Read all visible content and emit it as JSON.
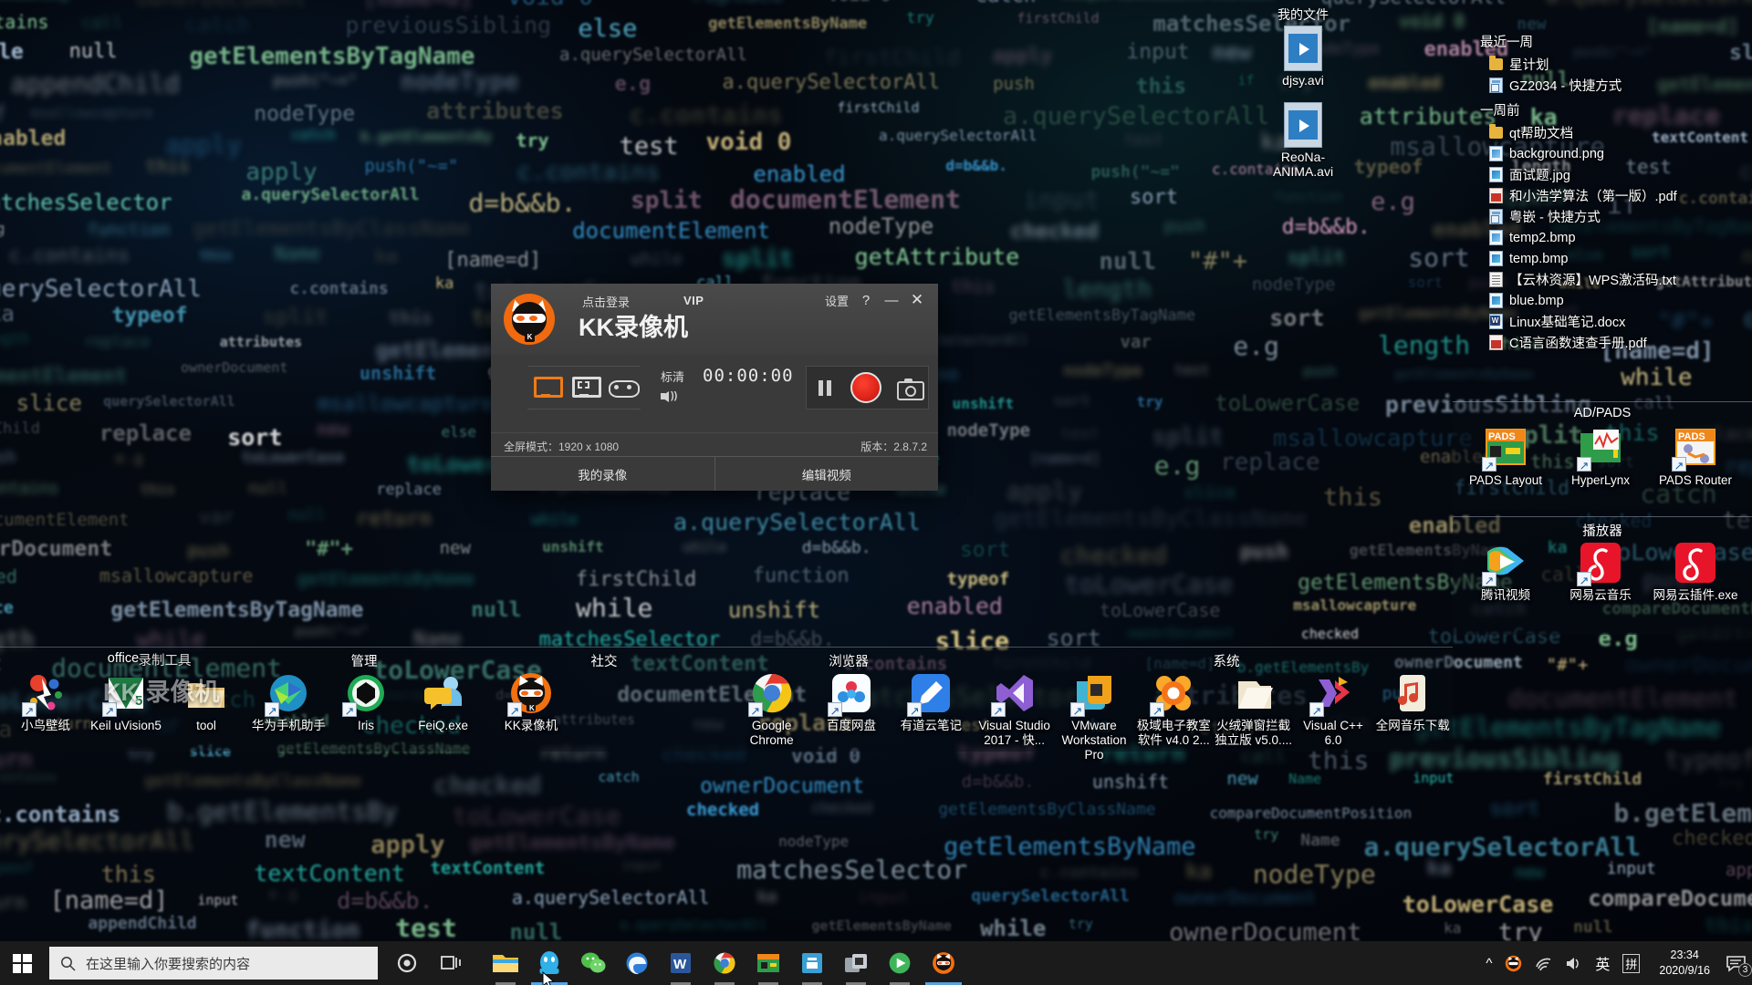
{
  "desktop": {
    "file_list": {
      "groups": [
        {
          "label": "最近一周",
          "items": [
            {
              "name": "星计划",
              "icon": "folder-icon",
              "type": "folder"
            },
            {
              "name": "GZ2034 - 快捷方式",
              "icon": "shortcut-icon",
              "type": "lnk"
            }
          ]
        },
        {
          "label": "一周前",
          "items": [
            {
              "name": "qt帮助文档",
              "icon": "folder-icon",
              "type": "folder"
            },
            {
              "name": "background.png",
              "icon": "image-file-icon",
              "type": "img"
            },
            {
              "name": "面试题.jpg",
              "icon": "image-file-icon",
              "type": "img2"
            },
            {
              "name": "和小浩学算法（第一版）.pdf",
              "icon": "pdf-file-icon",
              "type": "pdf"
            },
            {
              "name": "粤嵌 - 快捷方式",
              "icon": "shortcut-icon",
              "type": "lnk"
            },
            {
              "name": "temp2.bmp",
              "icon": "image-file-icon",
              "type": "img"
            },
            {
              "name": "temp.bmp",
              "icon": "image-file-icon",
              "type": "img2"
            },
            {
              "name": "【云林资源】WPS激活码.txt",
              "icon": "text-file-icon",
              "type": "txt"
            },
            {
              "name": "blue.bmp",
              "icon": "image-file-icon",
              "type": "img2"
            },
            {
              "name": "Linux基础笔记.docx",
              "icon": "word-file-icon",
              "type": "docx"
            },
            {
              "name": "C语言函数速查手册.pdf",
              "icon": "pdf-file-icon",
              "type": "pdf"
            }
          ]
        }
      ]
    },
    "video_icons": [
      {
        "label": "我的文件",
        "file": "djsy.avi",
        "icon": "avi-file-icon"
      },
      {
        "label": "",
        "file": "ReoNa-ANIMA.avi",
        "icon": "avi-file-icon"
      }
    ],
    "fences": [
      {
        "title": "office",
        "items": [
          {
            "label": "小鸟壁纸",
            "icon": "bird-wallpaper-icon",
            "shortcut": true
          },
          {
            "label": "Keil uVision5",
            "icon": "keil-uvision-icon",
            "shortcut": true
          },
          {
            "label": "tool",
            "icon": "folder-open-icon",
            "shortcut": false
          }
        ]
      },
      {
        "title": "录制工具",
        "items": [
          {
            "label": "KK 录像机",
            "icon": "kk-recorder-watermark-icon",
            "shortcut": false
          }
        ]
      },
      {
        "title": "管理",
        "items": [
          {
            "label": "华为手机助手",
            "icon": "huawei-hisuite-icon",
            "shortcut": true
          },
          {
            "label": "Iris",
            "icon": "iris-icon",
            "shortcut": true
          },
          {
            "label": "FeiQ.exe",
            "icon": "feiq-icon",
            "shortcut": false
          }
        ]
      },
      {
        "title": "社交",
        "items": [
          {
            "label": "KK录像机",
            "icon": "kk-recorder-icon",
            "shortcut": true
          }
        ]
      },
      {
        "title": "浏览器",
        "items": [
          {
            "label": "Google Chrome",
            "icon": "chrome-icon",
            "shortcut": true
          },
          {
            "label": "百度网盘",
            "icon": "baidu-netdisk-icon",
            "shortcut": true
          },
          {
            "label": "有道云笔记",
            "icon": "youdao-note-icon",
            "shortcut": true
          }
        ]
      },
      {
        "title": "系统",
        "items": [
          {
            "label": "Visual Studio 2017 - 快...",
            "icon": "visual-studio-icon",
            "shortcut": true
          },
          {
            "label": "VMware Workstation Pro",
            "icon": "vmware-icon",
            "shortcut": true
          },
          {
            "label": "极域电子教室软件 v4.0 2...",
            "icon": "jiyu-classroom-icon",
            "shortcut": true
          },
          {
            "label": "火绒弹窗拦截独立版 v5.0....",
            "icon": "huorong-popup-icon",
            "shortcut": false
          },
          {
            "label": "Visual C++ 6.0",
            "icon": "visual-cpp-icon",
            "shortcut": true
          },
          {
            "label": "全网音乐下载",
            "icon": "music-download-icon",
            "shortcut": false
          }
        ]
      },
      {
        "title": "AD/PADS",
        "items": [
          {
            "label": "PADS Layout",
            "icon": "pads-layout-icon",
            "shortcut": true
          },
          {
            "label": "HyperLynx",
            "icon": "hyperlynx-icon",
            "shortcut": true
          },
          {
            "label": "PADS Router",
            "icon": "pads-router-icon",
            "shortcut": true
          }
        ]
      },
      {
        "title": "播放器",
        "items": [
          {
            "label": "腾讯视频",
            "icon": "tencent-video-icon",
            "shortcut": true
          },
          {
            "label": "网易云音乐",
            "icon": "netease-music-icon",
            "shortcut": true
          },
          {
            "label": "网易云插件.exe",
            "icon": "netease-plugin-icon",
            "shortcut": false
          }
        ]
      }
    ]
  },
  "kk_window": {
    "login_text": "点击登录",
    "vip_label": "VIP",
    "app_name": "KK录像机",
    "settings_label": "设置",
    "help_icon": "?",
    "minimize_icon": "—",
    "close_icon": "✕",
    "modes": [
      {
        "name": "fullscreen-mode",
        "icon": "monitor-icon",
        "selected": true
      },
      {
        "name": "region-mode",
        "icon": "region-select-icon",
        "selected": false
      },
      {
        "name": "game-mode",
        "icon": "gamepad-icon",
        "selected": false
      }
    ],
    "quality_label": "标清",
    "sound_icon": "speaker-icon",
    "timer": "00:00:00",
    "controls": [
      {
        "name": "pause-button",
        "icon": "pause-icon"
      },
      {
        "name": "record-button",
        "icon": "record-circle-icon"
      },
      {
        "name": "screenshot-button",
        "icon": "camera-icon"
      }
    ],
    "status_mode": "全屏模式：1920 x 1080",
    "version": "版本：2.8.7.2",
    "footer_buttons": [
      {
        "label": "我的录像",
        "name": "my-recordings-button"
      },
      {
        "label": "编辑视频",
        "name": "edit-video-button"
      }
    ]
  },
  "taskbar": {
    "start_icon": "windows-logo-icon",
    "search": {
      "placeholder": "在这里输入你要搜索的内容",
      "icon": "search-icon"
    },
    "cortana_icon": "cortana-circle-icon",
    "taskview_icon": "task-view-icon",
    "pinned": [
      {
        "name": "file-explorer-icon",
        "label": "文件资源管理器",
        "state": "running"
      },
      {
        "name": "qq-icon",
        "label": "QQ",
        "state": "active"
      },
      {
        "name": "wechat-icon",
        "label": "微信",
        "state": "none"
      },
      {
        "name": "edge-icon",
        "label": "Microsoft Edge",
        "state": "none"
      },
      {
        "name": "word-icon",
        "label": "Word",
        "state": "running"
      },
      {
        "name": "chrome-icon",
        "label": "Google Chrome",
        "state": "running"
      },
      {
        "name": "pads-icon",
        "label": "PADS",
        "state": "running"
      },
      {
        "name": "store-icon",
        "label": "Microsoft Store",
        "state": "running"
      },
      {
        "name": "vmware-icon",
        "label": "VMware",
        "state": "running"
      },
      {
        "name": "media-player-icon",
        "label": "腾讯视频",
        "state": "running"
      },
      {
        "name": "kk-recorder-icon",
        "label": "KK录像机",
        "state": "active"
      }
    ],
    "tray": {
      "chevron_icon": "^",
      "kk_tray_icon": "kk-recorder-tray-icon",
      "network_icon": "wifi-icon",
      "volume_icon": "speaker-icon",
      "ime_lang": "英",
      "ime_mode": "拼",
      "time": "23:34",
      "date": "2020/9/16",
      "notification_icon": "action-center-icon",
      "notification_count": "3"
    }
  },
  "colors": {
    "accent_orange": "#ef7b16",
    "record_red": "#c4120a",
    "taskbar_bg": "#1b1b1b",
    "window_bg": "#3a3a3a",
    "search_bg": "#eaeaea",
    "taskbar_active": "#5aa2df"
  }
}
